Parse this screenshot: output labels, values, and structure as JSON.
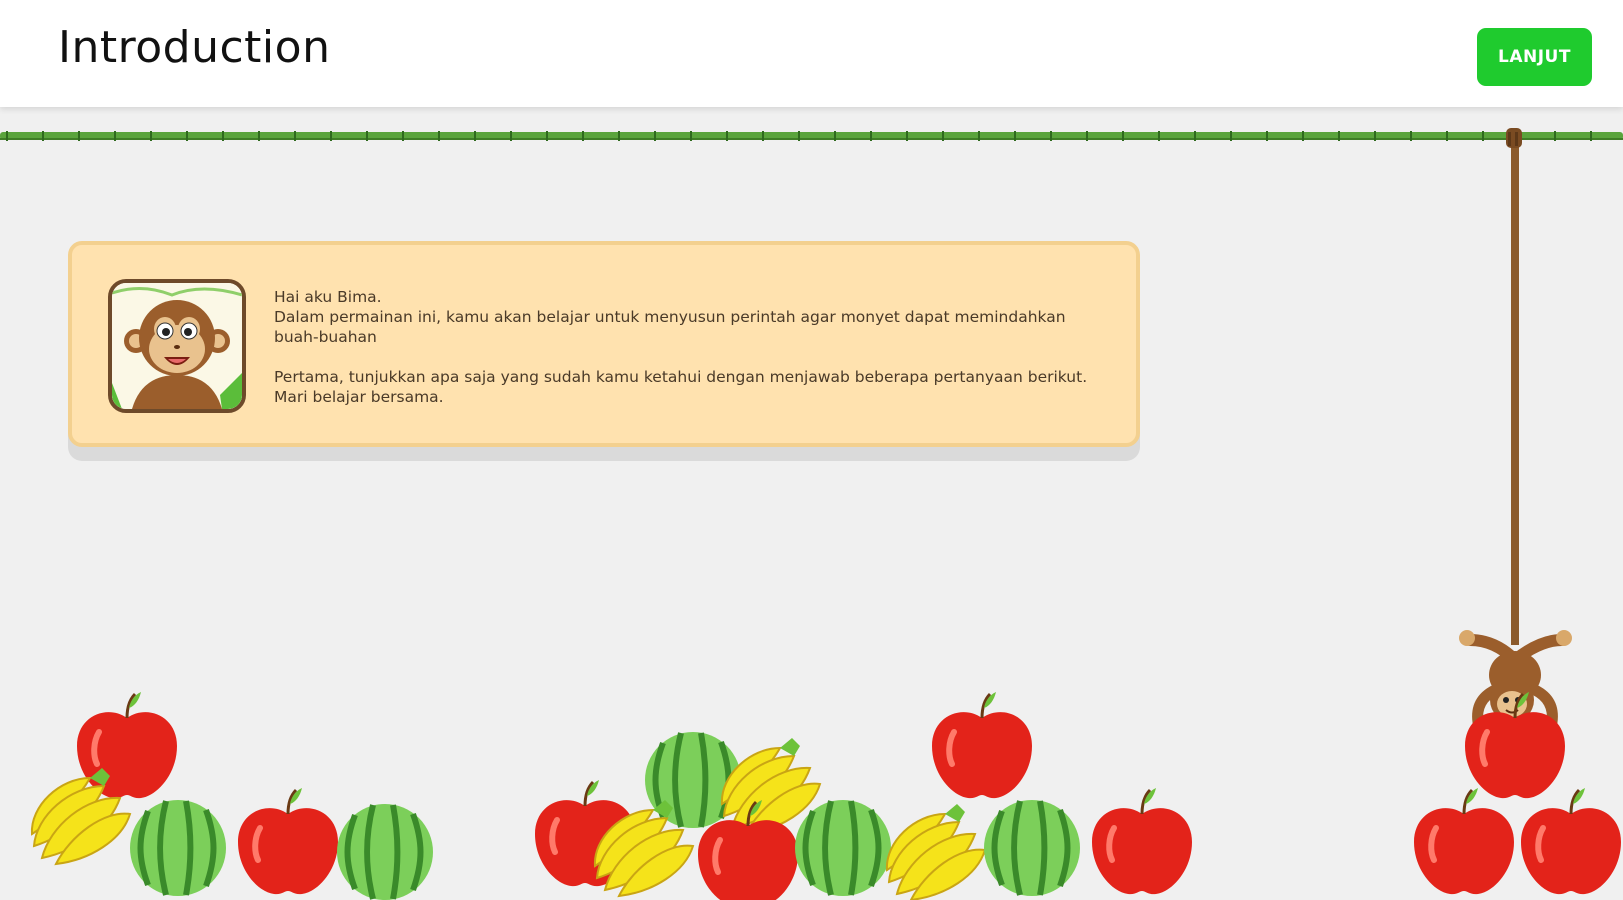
{
  "header": {
    "title": "Introduction",
    "next_label": "LANJUT",
    "next_color": "#1fcb2e"
  },
  "intro": {
    "greeting": "Hai aku Bima.",
    "line1": "Dalam permainan ini, kamu akan belajar untuk menyusun perintah agar monyet dapat memindahkan",
    "line2": "buah-buahan",
    "line3": "Pertama, tunjukkan apa saja yang sudah kamu ketahui dengan menjawab beberapa pertanyaan berikut.",
    "line4": "Mari belajar bersama."
  },
  "colors": {
    "vine": "#5aa43c",
    "rope": "#8b5a2b",
    "apple": "#e3231a",
    "banana": "#f5e31a",
    "watermelon": "#7ccf5a"
  }
}
